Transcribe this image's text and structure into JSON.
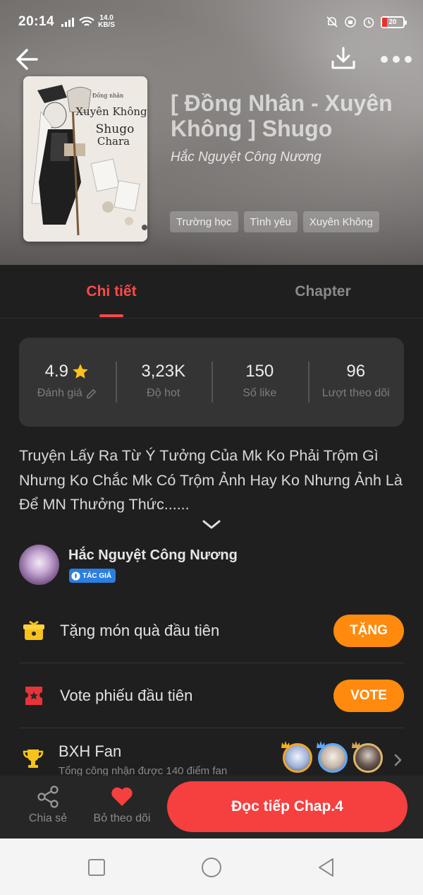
{
  "status_bar": {
    "time": "20:14",
    "speed_value": "14.0",
    "speed_unit": "KB/S",
    "battery": "20"
  },
  "story": {
    "title": "[ Đồng Nhân - Xuyên Không ] Shugo",
    "author": "Hắc Nguyệt Công Nương",
    "tags": [
      "Trường học",
      "Tình yêu",
      "Xuyên Không"
    ]
  },
  "tabs": {
    "detail": "Chi tiết",
    "chapter": "Chapter"
  },
  "stats": [
    {
      "value": "4.9",
      "label": "Đánh giá"
    },
    {
      "value": "3,23K",
      "label": "Độ hot"
    },
    {
      "value": "150",
      "label": "Số like"
    },
    {
      "value": "96",
      "label": "Lượt theo dõi"
    }
  ],
  "description": "Truyện Lấy Ra Từ Ý Tưởng Của Mk Ko Phải Trộm Gì Nhưng Ko Chắc Mk Có Trộm Ảnh Hay Ko Nhưng Ảnh Là Để MN Thưởng Thức......",
  "author_block": {
    "name": "Hắc Nguyệt Công Nương",
    "badge": "TÁC GIẢ"
  },
  "actions": {
    "gift_label": "Tặng món quà đầu tiên",
    "gift_button": "TẶNG",
    "vote_label": "Vote phiếu đầu tiên",
    "vote_button": "VOTE",
    "fan_title": "BXH Fan",
    "fan_subtitle": "Tổng công nhận được 140 điểm fan"
  },
  "bottom_bar": {
    "share": "Chia sẻ",
    "unfollow": "Bỏ theo dõi",
    "continue": "Đọc tiếp Chap.4"
  },
  "colors": {
    "accent": "#ff4a4a",
    "orange": "#ff8a0d",
    "read_button": "#f63f3f"
  }
}
